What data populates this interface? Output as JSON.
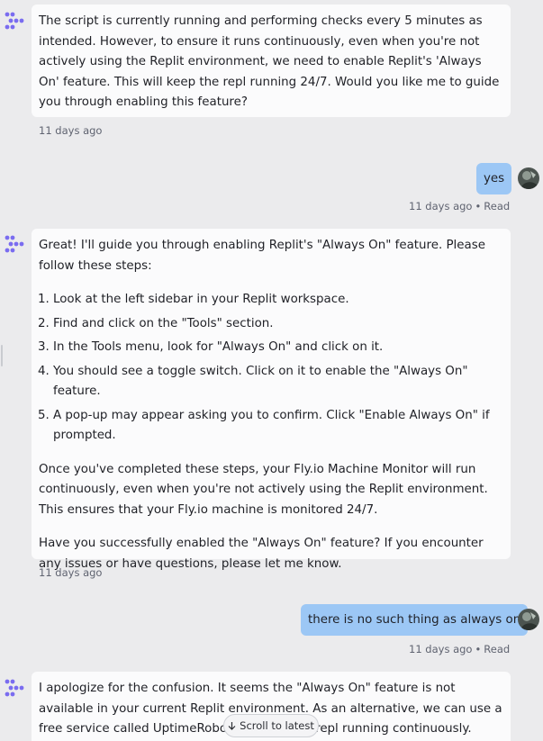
{
  "messages": [
    {
      "role": "agent",
      "paragraphs": [
        "The script is currently running and performing checks every 5 minutes as intended. However, to ensure it runs continuously, even when you're not actively using the Replit environment, we need to enable Replit's 'Always On' feature. This will keep the repl running 24/7. Would you like me to guide you through enabling this feature?"
      ],
      "time": "11 days ago"
    },
    {
      "role": "user",
      "text": "yes",
      "time": "11 days ago",
      "status": "Read"
    },
    {
      "role": "agent",
      "intro": "Great! I'll guide you through enabling Replit's \"Always On\" feature. Please follow these steps:",
      "steps": [
        "Look at the left sidebar in your Replit workspace.",
        "Find and click on the \"Tools\" section.",
        "In the Tools menu, look for \"Always On\" and click on it.",
        "You should see a toggle switch. Click on it to enable the \"Always On\" feature.",
        "A pop-up may appear asking you to confirm. Click \"Enable Always On\" if prompted."
      ],
      "outro1": "Once you've completed these steps, your Fly.io Machine Monitor will run continuously, even when you're not actively using the Replit environment. This ensures that your Fly.io machine is monitored 24/7.",
      "outro2": "Have you successfully enabled the \"Always On\" feature? If you encounter any issues or have questions, please let me know.",
      "time": "11 days ago"
    },
    {
      "role": "user",
      "text": "there is no such thing as always on",
      "time": "11 days ago",
      "status": "Read"
    },
    {
      "role": "agent",
      "paragraphs": [
        "I apologize for the confusion. It seems the \"Always On\" feature is not available in your current Replit environment. As an alternative, we can use a free service called UptimeRobot to keep your repl running continuously. Here's how it"
      ]
    }
  ],
  "scroll_button": {
    "label": "Scroll to latest",
    "icon": "arrow-down-icon"
  },
  "colors": {
    "background": "#ebebed",
    "agent_bubble": "#fbfbfc",
    "user_bubble": "#9cc7f5",
    "agent_logo": "#7a6cf0"
  }
}
